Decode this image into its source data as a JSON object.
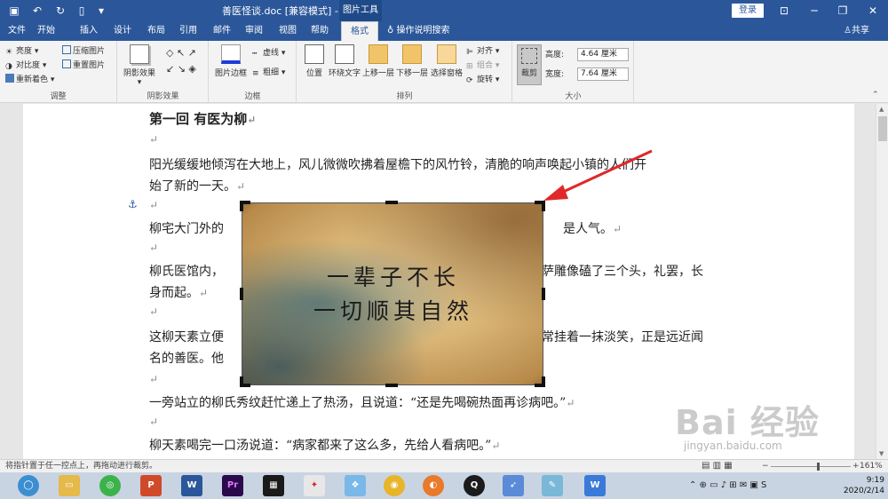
{
  "window": {
    "title": "善医怪谈.doc [兼容模式] - Word",
    "context_tab": "图片工具",
    "login_button": "登录"
  },
  "tabs": [
    "文件",
    "开始",
    "插入",
    "设计",
    "布局",
    "引用",
    "邮件",
    "审阅",
    "视图",
    "帮助",
    "格式"
  ],
  "active_tab": "格式",
  "tell_me": "操作说明搜索",
  "share": "共享",
  "ribbon": {
    "adjust": {
      "brightness": "亮度",
      "contrast": "对比度",
      "recolor": "重新着色",
      "compress": "压缩图片",
      "reset": "重置图片",
      "label": "调整"
    },
    "shadow": {
      "effect": "阴影效果",
      "label": "阴影效果"
    },
    "border": {
      "picture_border": "图片边框",
      "dashes": "虚线",
      "weight": "粗细",
      "label": "边框"
    },
    "arrange": {
      "position": "位置",
      "wrap": "环绕文字",
      "forward": "上移一层",
      "backward": "下移一层",
      "selection": "选择窗格",
      "align": "对齐",
      "group": "组合",
      "rotate": "旋转",
      "label": "排列"
    },
    "size": {
      "crop": "裁剪",
      "height_label": "高度:",
      "height_value": "4.64 厘米",
      "width_label": "宽度:",
      "width_value": "7.64 厘米",
      "label": "大小"
    }
  },
  "document": {
    "heading": "第一回  有医为柳",
    "p1a": "阳光缓缓地倾泻在大地上，风儿微微吹拂着屋檐下的风竹铃，清脆的响声唤起小镇的人们开",
    "p1b": "始了新的一天。",
    "p2a": "柳宅大门外的",
    "p2b": "是人气。",
    "p3a": "柳氏医馆内，",
    "p3b": "萨雕像磕了三个头，礼罢，长",
    "p3c": "身而起。",
    "p4a": "这柳天素立便",
    "p4b": "常挂着一抹淡笑，正是远近闻",
    "p4c": "名的善医。他",
    "p5": "一旁站立的柳氏秀纹赶忙递上了热汤，且说道：“还是先喝碗热面再诊病吧。”",
    "p6": "柳天素喝完一口汤说道：“病家都来了这么多，先给人看病吧。”",
    "para_mark": "↵",
    "anchor": "⚓"
  },
  "picture": {
    "line1": "一辈子不长",
    "line2": "一切顺其自然"
  },
  "status": {
    "message": "将指针置于任一控点上，再拖动进行裁剪。",
    "zoom": "161%"
  },
  "taskbar": {
    "time": "9:19",
    "date": "2020/2/14"
  },
  "watermark": {
    "main": "Bai 经验",
    "sub": "jingyan.baidu.com"
  },
  "colors": {
    "word_blue": "#2b579a",
    "annotation_arrow": "#e0282a"
  }
}
